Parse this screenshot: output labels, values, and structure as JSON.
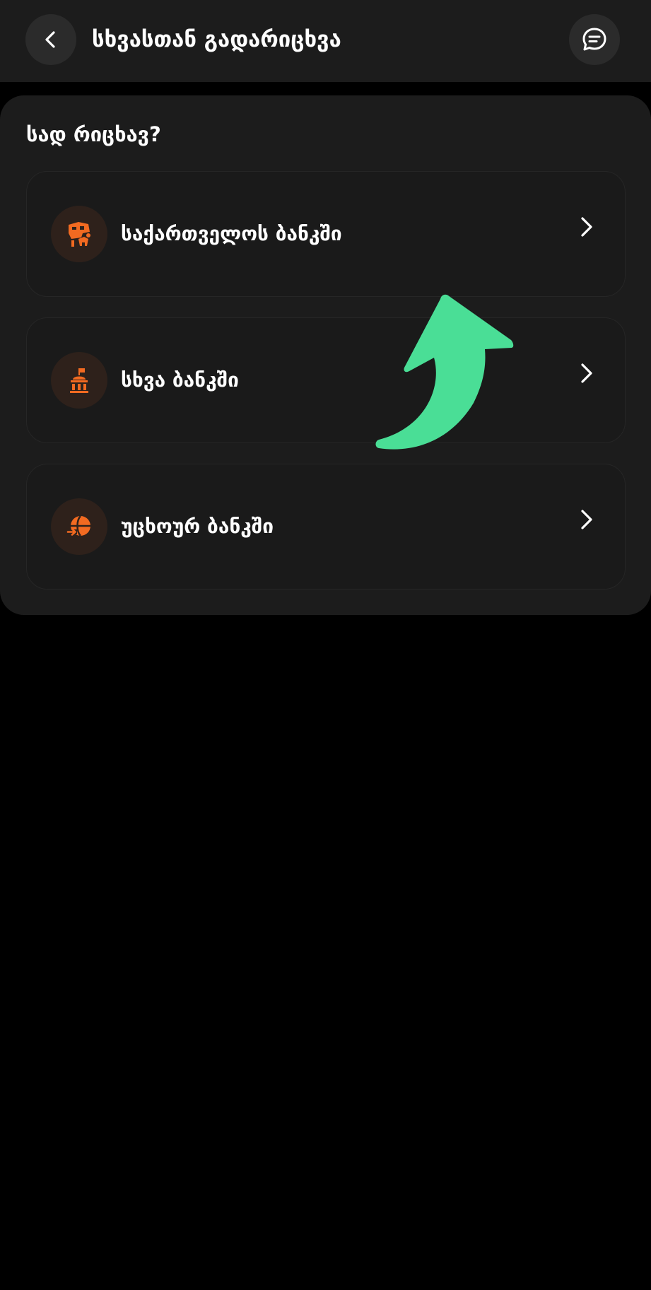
{
  "header": {
    "title": "სხვასთან გადარიცხვა",
    "back_icon": "chevron-left-icon",
    "chat_icon": "chat-bubble-icon"
  },
  "section": {
    "heading": "სად რიცხავ?"
  },
  "options": [
    {
      "label": "საქართველოს ბანკში",
      "icon": "bank-of-georgia-icon"
    },
    {
      "label": "სხვა ბანკში",
      "icon": "other-bank-icon"
    },
    {
      "label": "უცხოურ ბანკში",
      "icon": "foreign-bank-globe-icon"
    }
  ],
  "colors": {
    "background": "#000000",
    "surface": "#1c1c1c",
    "accent_orange": "#f26a21",
    "annotation_green": "#4ade96"
  }
}
